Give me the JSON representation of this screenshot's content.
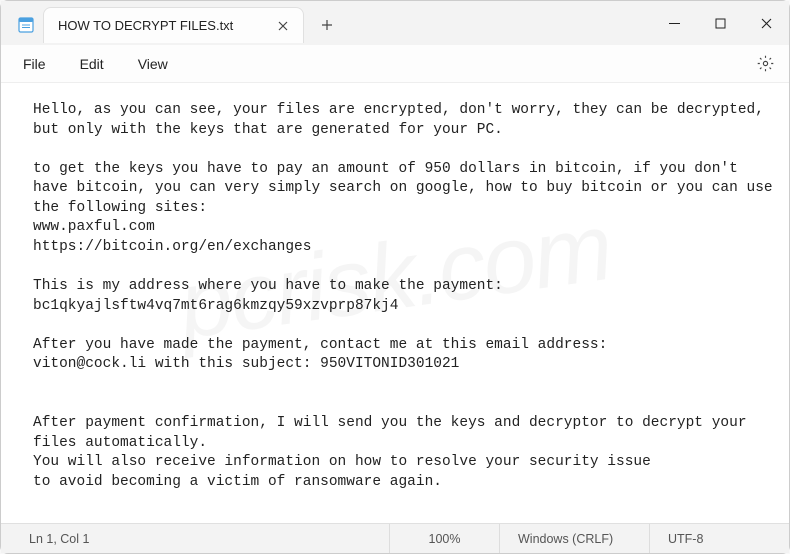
{
  "tab": {
    "title": "HOW TO DECRYPT FILES.txt"
  },
  "menu": {
    "file": "File",
    "edit": "Edit",
    "view": "View"
  },
  "content": "Hello, as you can see, your files are encrypted, don't worry, they can be decrypted, but only with the keys that are generated for your PC.\n\nto get the keys you have to pay an amount of 950 dollars in bitcoin, if you don't have bitcoin, you can very simply search on google, how to buy bitcoin or you can use the following sites:\nwww.paxful.com\nhttps://bitcoin.org/en/exchanges\n\nThis is my address where you have to make the payment:\nbc1qkyajlsftw4vq7mt6rag6kmzqy59xzvprp87kj4\n\nAfter you have made the payment, contact me at this email address:\nviton@cock.li with this subject: 950VITONID301021\n\n\nAfter payment confirmation, I will send you the keys and decryptor to decrypt your files automatically.\nYou will also receive information on how to resolve your security issue\nto avoid becoming a victim of ransomware again.",
  "status": {
    "position": "Ln 1, Col 1",
    "zoom": "100%",
    "eol": "Windows (CRLF)",
    "encoding": "UTF-8"
  },
  "watermark": "pcrisk.com"
}
